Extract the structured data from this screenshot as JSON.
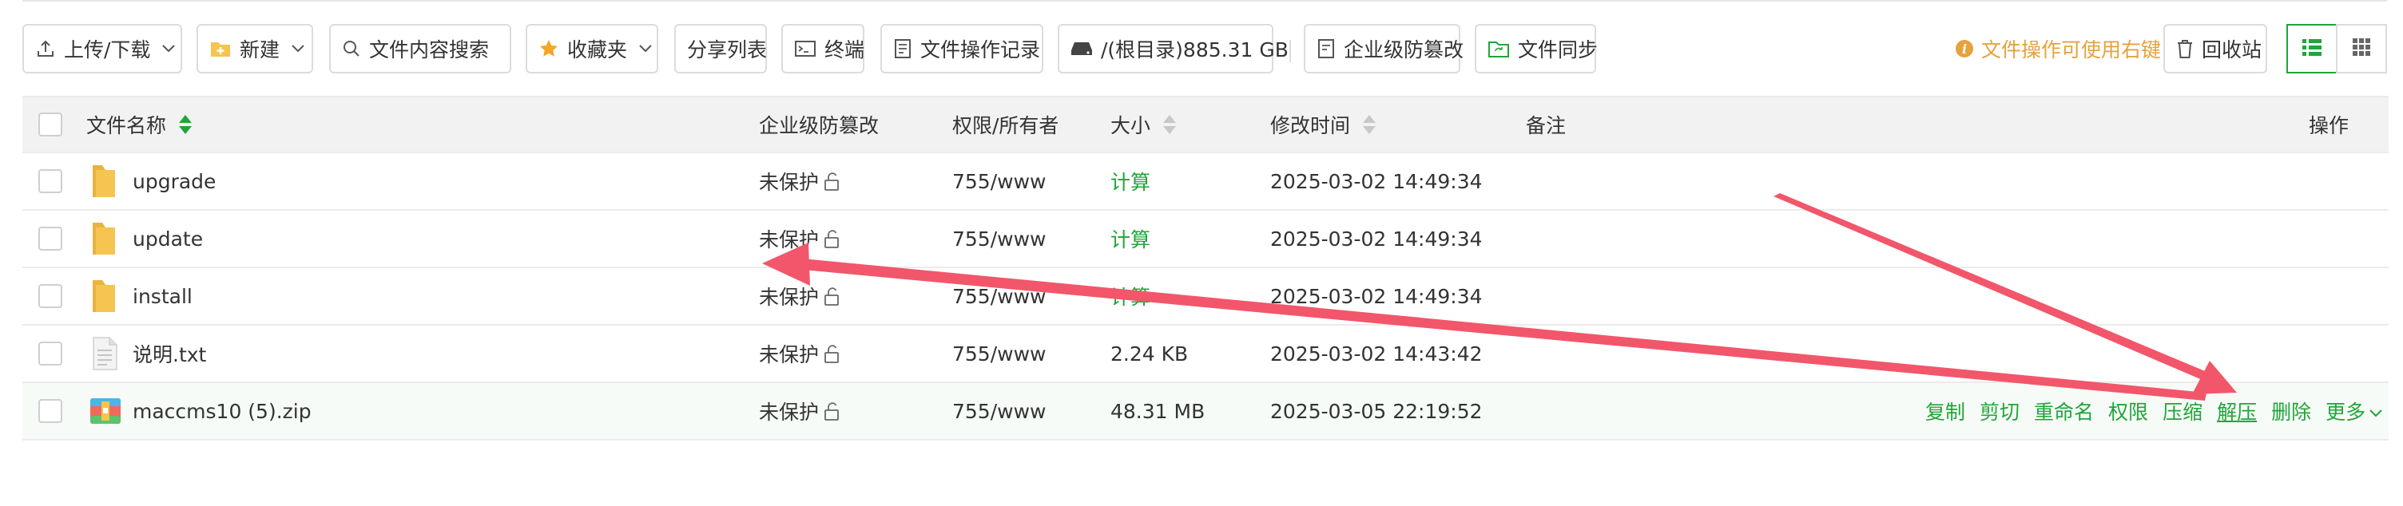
{
  "toolbar": {
    "upload_download": "上传/下载",
    "new": "新建",
    "search": "文件内容搜索",
    "favorites": "收藏夹",
    "share_list": "分享列表",
    "terminal": "终端",
    "op_log": "文件操作记录",
    "disk": "/(根目录)885.31 GB",
    "tamper": "企业级防篡改",
    "sync": "文件同步",
    "hint": "文件操作可使用右键",
    "recycle": "回收站"
  },
  "table": {
    "headers": {
      "name": "文件名称",
      "tamper": "企业级防篡改",
      "perm": "权限/所有者",
      "size": "大小",
      "mtime": "修改时间",
      "note": "备注",
      "ops": "操作"
    },
    "rows": [
      {
        "name": "upgrade",
        "type": "folder",
        "tamper": "未保护",
        "perm": "755/www",
        "size": "计算",
        "mtime": "2025-03-02 14:49:34"
      },
      {
        "name": "update",
        "type": "folder",
        "tamper": "未保护",
        "perm": "755/www",
        "size": "计算",
        "mtime": "2025-03-02 14:49:34"
      },
      {
        "name": "install",
        "type": "folder",
        "tamper": "未保护",
        "perm": "755/www",
        "size": "计算",
        "mtime": "2025-03-02 14:49:34"
      },
      {
        "name": "说明.txt",
        "type": "text-file",
        "tamper": "未保护",
        "perm": "755/www",
        "size": "2.24 KB",
        "mtime": "2025-03-02 14:43:42"
      },
      {
        "name": "maccms10 (5).zip",
        "type": "zip-file",
        "tamper": "未保护",
        "perm": "755/www",
        "size": "48.31 MB",
        "mtime": "2025-03-05 22:19:52"
      }
    ],
    "row_actions": {
      "copy": "复制",
      "cut": "剪切",
      "rename": "重命名",
      "perm": "权限",
      "compress": "压缩",
      "extract": "解压",
      "delete": "删除",
      "more": "更多"
    }
  },
  "colors": {
    "accent": "#20a53a",
    "hint": "#e6a23c",
    "arrow": "#f2566b",
    "folder": "#f5c451"
  }
}
